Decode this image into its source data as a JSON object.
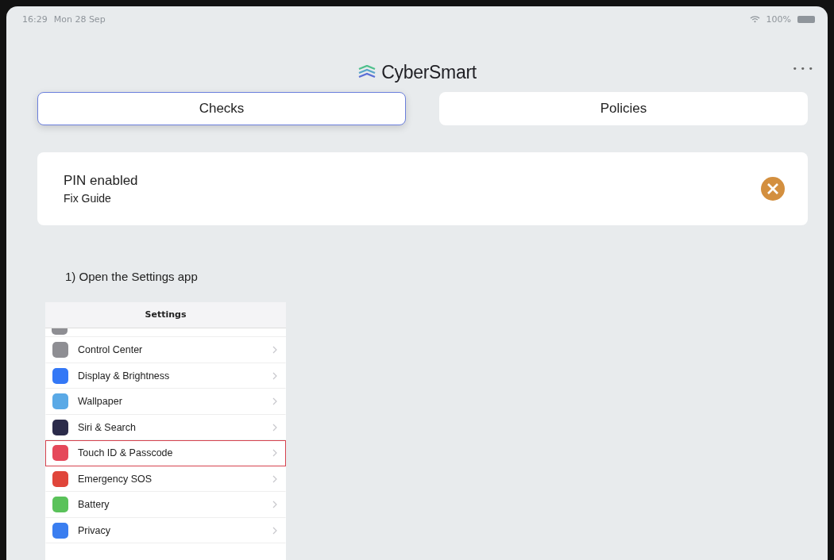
{
  "status_bar": {
    "time": "16:29",
    "date": "Mon 28 Sep",
    "battery": "100%"
  },
  "header": {
    "title": "CyberSmart",
    "more": "• • •"
  },
  "tabs": [
    {
      "label": "Checks",
      "selected": true
    },
    {
      "label": "Policies",
      "selected": false
    }
  ],
  "check": {
    "title": "PIN enabled",
    "link": "Fix Guide",
    "passed": false
  },
  "step": "1) Open the Settings app",
  "settings_screenshot": {
    "title": "Settings",
    "rows": [
      {
        "label": "Control Center",
        "color": "#8e8e93",
        "highlighted": false
      },
      {
        "label": "Display & Brightness",
        "color": "#3478f6",
        "highlighted": false
      },
      {
        "label": "Wallpaper",
        "color": "#5aa9e6",
        "highlighted": false
      },
      {
        "label": "Siri & Search",
        "color": "#2b2b4a",
        "highlighted": false
      },
      {
        "label": "Touch ID & Passcode",
        "color": "#e5485a",
        "highlighted": true
      },
      {
        "label": "Emergency SOS",
        "color": "#e0453a",
        "highlighted": false
      },
      {
        "label": "Battery",
        "color": "#5ac25a",
        "highlighted": false
      },
      {
        "label": "Privacy",
        "color": "#3a7ef0",
        "highlighted": false
      }
    ]
  }
}
